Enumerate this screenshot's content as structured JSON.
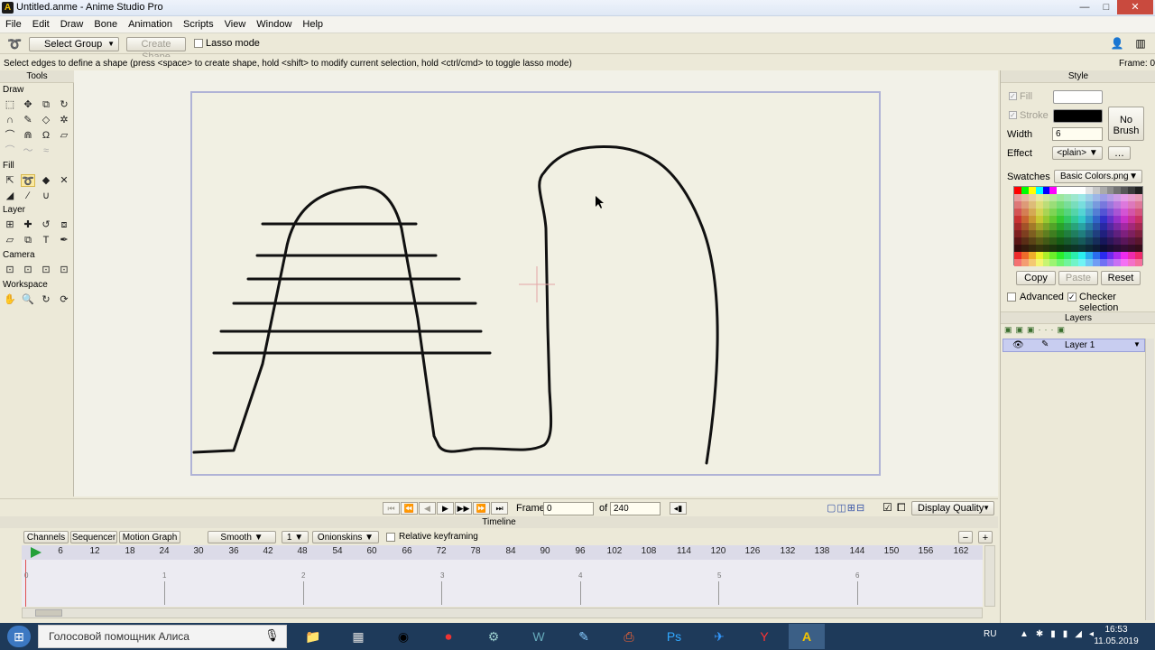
{
  "window": {
    "title": "Untitled.anme - Anime Studio Pro",
    "minimize": "—",
    "maximize": "□",
    "close": "✕"
  },
  "menu": [
    "File",
    "Edit",
    "Draw",
    "Bone",
    "Animation",
    "Scripts",
    "View",
    "Window",
    "Help"
  ],
  "tool_options": {
    "group_select": "Select Group",
    "create_shape": "Create Shape",
    "lasso_mode": "Lasso mode"
  },
  "status": {
    "hint": "Select edges to define a shape (press <space> to create shape, hold <shift> to modify current selection, hold <ctrl/cmd> to toggle lasso mode)",
    "frame": "Frame: 0"
  },
  "tools": {
    "title": "Tools",
    "sections": [
      "Draw",
      "Fill",
      "Layer",
      "Camera",
      "Workspace"
    ]
  },
  "style": {
    "title": "Style",
    "fill_label": "Fill",
    "stroke_label": "Stroke",
    "fill_color": "#ffffff",
    "stroke_color": "#000000",
    "width_label": "Width",
    "width_value": "6",
    "effect_label": "Effect",
    "effect_value": "<plain>",
    "no_brush": "No Brush",
    "swatches_label": "Swatches",
    "swatches_value": "Basic Colors.png",
    "copy": "Copy",
    "paste": "Paste",
    "reset": "Reset",
    "advanced": "Advanced",
    "checker": "Checker selection"
  },
  "layers": {
    "title": "Layers",
    "items": [
      "Layer 1"
    ]
  },
  "playback": {
    "frame_label": "Frame",
    "frame_value": "0",
    "of_label": "of",
    "total_frames": "240",
    "display_quality": "Display Quality"
  },
  "timeline": {
    "title": "Timeline",
    "tabs": [
      "Channels",
      "Sequencer",
      "Motion Graph"
    ],
    "interp": "Smooth",
    "keys": "1",
    "onionskins": "Onionskins",
    "relative": "Relative keyframing",
    "ruler": [
      "6",
      "12",
      "18",
      "24",
      "30",
      "36",
      "42",
      "48",
      "54",
      "60",
      "66",
      "72",
      "78",
      "84",
      "90",
      "96",
      "102",
      "108",
      "114",
      "120",
      "126",
      "132",
      "138",
      "144",
      "150",
      "156",
      "162"
    ],
    "seconds": [
      "0",
      "1",
      "2",
      "3",
      "4",
      "5",
      "6"
    ]
  },
  "taskbar": {
    "assistant": "Голосовой помощник Алиса",
    "lang": "RU",
    "time": "16:53",
    "date": "11.05.2019"
  }
}
